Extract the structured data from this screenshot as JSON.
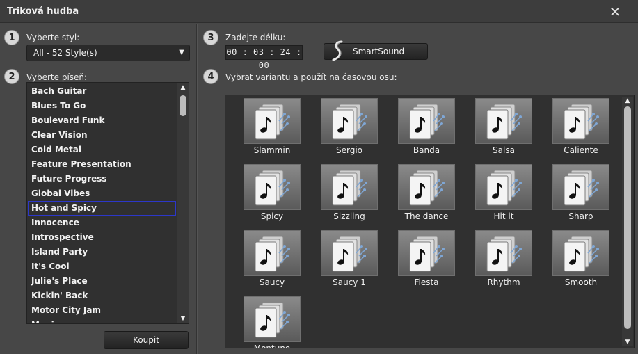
{
  "window": {
    "title": "Triková hudba",
    "close_glyph": "✕"
  },
  "steps": [
    "1",
    "2",
    "3",
    "4"
  ],
  "style": {
    "label": "Vyberte styl:",
    "value": "All - 52 Style(s)",
    "arrow": "▼"
  },
  "songs": {
    "label": "Vyberte píseň:",
    "items": [
      "Bach Guitar",
      "Blues To Go",
      "Boulevard Funk",
      "Clear Vision",
      "Cold Metal",
      "Feature Presentation",
      "Future Progress",
      "Global Vibes",
      "Hot and Spicy",
      "Innocence",
      "Introspective",
      "Island Party",
      "It's Cool",
      "Julie's Place",
      "Kickin' Back",
      "Motor City Jam",
      "Magic"
    ],
    "selected": "Hot and Spicy",
    "scroll_up": "▲",
    "scroll_down": "▼"
  },
  "buy_button": "Koupit",
  "length": {
    "label": "Zadejte délku:",
    "value": "00 : 03 : 24 : 00"
  },
  "smartsound_button": {
    "label": "SmartSound",
    "icon": "smartsound-logo-icon"
  },
  "variants": {
    "label": "Vybrat variantu a použít na časovou osu:",
    "items": [
      "Slammin",
      "Sergio",
      "Banda",
      "Salsa",
      "Caliente",
      "Spicy",
      "Sizzling",
      "The dance",
      "Hit it",
      "Sharp",
      "Saucy",
      "Saucy 1",
      "Fiesta",
      "Rhythm",
      "Smooth",
      "Montuno"
    ],
    "tile_icon": "music-file-icon",
    "scroll_up": "▲",
    "scroll_down": "▼"
  },
  "colors": {
    "background": "#474747",
    "selection_border": "#2c37c9",
    "list_background": "#303030"
  }
}
